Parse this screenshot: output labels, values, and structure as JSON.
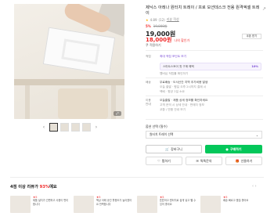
{
  "product": {
    "title": "제닉스 아레나 원터치 트레이 / 프로 모션데스크 전용 원격엑셀 트레이",
    "rating": "4.89",
    "review_count": "(12)",
    "review_link": "리뷰 작성",
    "share_label": "↗",
    "discount_percent": "5%",
    "original_price": "19,000원",
    "price": "19,000원",
    "sale_price": "18,000원",
    "sale_suffix": "나의 할인가",
    "coupon_button": "쿠폰 받기",
    "coupon_label": "쿠 적용하기",
    "image_nav": [
      "‹",
      "›"
    ],
    "zoom_label": "⤢"
  },
  "info": {
    "points_key": "적립",
    "points_value": "최대 적립 포인트 보기",
    "points_sub": "멤버십 적립률 확인하기",
    "member_label": "스마트스토어 첫 구매 혜택",
    "member_pct": "10%",
    "shipping_key": "배송",
    "shipping_value": "무료배송 · 도서산간 지역 추가비용 발생",
    "shipping_sub": "오늘 출발 · 평일 오후 2시까지 결제 시",
    "shipping_sub2": "택배 · 평균 2일 소요",
    "delivery_key": "이용안내",
    "delivery_value": "오늘출발 · 제품 상세 정보를 확인하세요",
    "delivery_sub": "고객 문의 시 상세 안내 · 판매자 정보",
    "delivery_sub2": "교환 / 반품 안내 보기"
  },
  "options": {
    "label": "옵션 선택 (필수)",
    "selected": "원터치 트레이 선택",
    "chevron": "⌄"
  },
  "actions": {
    "cart": "장바구니",
    "buy": "구매하기",
    "like": "찜하기",
    "talk": "톡톡문의",
    "present": "선물하기"
  },
  "reco": {
    "title_prefix": "4점 이상 리뷰가 ",
    "title_pct": "93%",
    "title_suffix": "예요",
    "arrows": "‹ ›",
    "cards": [
      {
        "stars": "★5",
        "text": "제품 설치가 간편하고 사용이 편리합니다"
      },
      {
        "stars": "★5",
        "text": "책상 아래 공간 활용도가 높아졌어요 만족합니다"
      },
      {
        "stars": "★5",
        "text": "튼튼하고 원터치로 쉽게 넣고 뺄 수 있어 좋아요"
      },
      {
        "stars": "★5",
        "text": "배송 빠르고 품질 좋아요"
      }
    ]
  },
  "colors": {
    "accent": "#03c75a",
    "sale": "#f02a2a",
    "purple": "#7a4bd6"
  }
}
